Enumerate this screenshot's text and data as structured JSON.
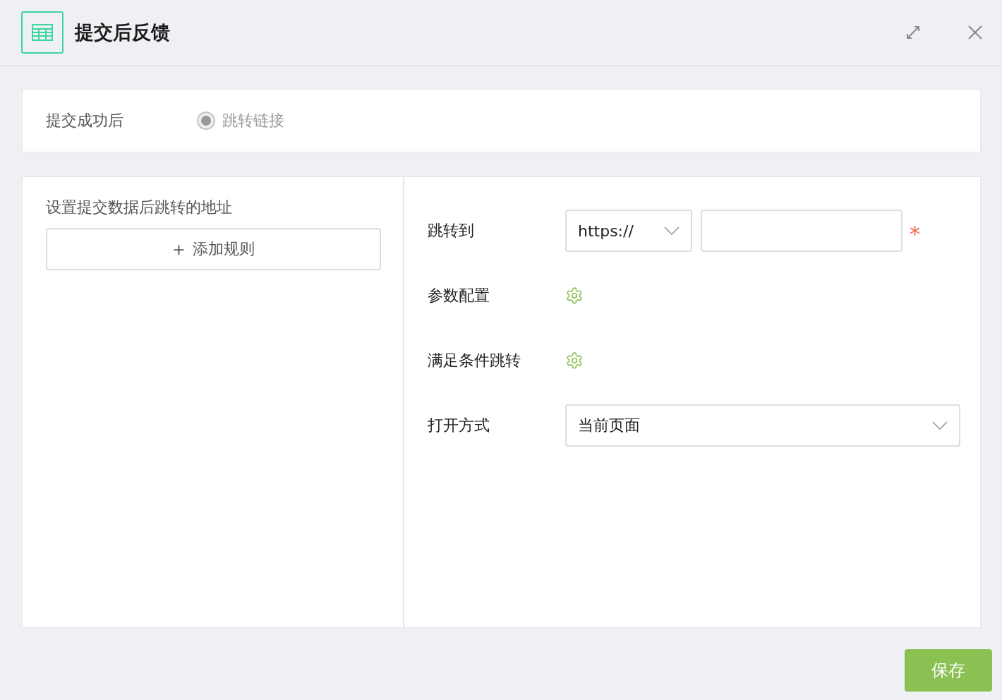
{
  "window": {
    "title": "提交后反馈"
  },
  "after_submit": {
    "label": "提交成功后",
    "options": [
      {
        "label": "跳转链接",
        "selected": true,
        "disabled": true
      }
    ]
  },
  "rules": {
    "title": "设置提交数据后跳转的地址",
    "add_button": {
      "icon": "+",
      "label": "添加规则"
    }
  },
  "settings": [
    {
      "kind": "url",
      "label": "跳转到",
      "protocol": "https://",
      "required_mark": "*"
    },
    {
      "kind": "gear",
      "label": "参数配置"
    },
    {
      "kind": "gear",
      "label": "满足条件跳转"
    },
    {
      "kind": "select",
      "label": "打开方式",
      "value": "当前页面"
    }
  ],
  "buttons": [
    {
      "label": "保存"
    }
  ]
}
